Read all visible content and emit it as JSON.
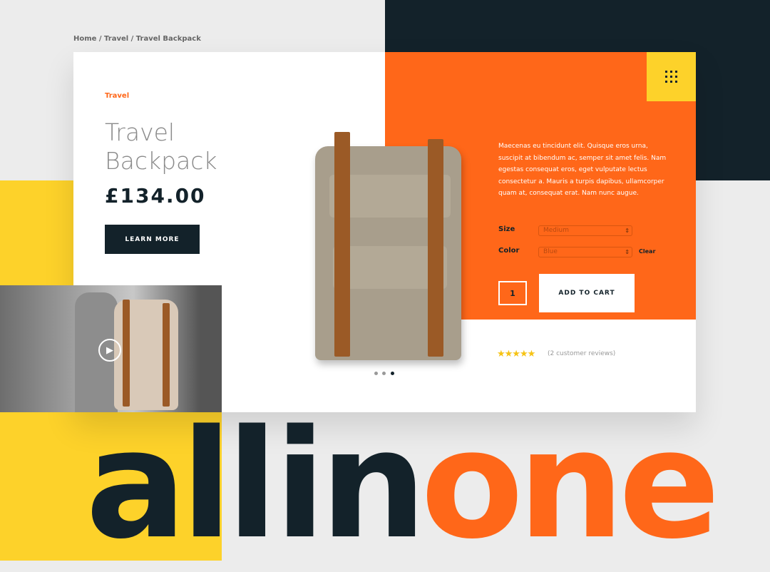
{
  "breadcrumb": "Home / Travel / Travel Backpack",
  "product": {
    "category": "Travel",
    "title": "Travel Backpack",
    "price": "£134.00",
    "learn_more": "LEARN MORE",
    "description": "Maecenas eu tincidunt elit. Quisque eros urna, suscipit at bibendum ac, semper sit amet felis. Nam egestas consequat eros, eget vulputate lectus consectetur a. Mauris a turpis dapibus, ullamcorper quam at, consequat erat. Nam nunc augue.",
    "size_label": "Size",
    "size_value": "Medium",
    "color_label": "Color",
    "color_value": "Blue",
    "clear": "Clear",
    "quantity": "1",
    "add_to_cart": "ADD TO CART",
    "rating": 4.5,
    "stars": "★★★★★",
    "reviews": "(2 customer reviews)"
  },
  "carousel": {
    "slides": 3,
    "active": 3
  },
  "headline": {
    "word1": "all",
    "word2": "in",
    "word3": "one"
  },
  "colors": {
    "orange": "#ff6719",
    "dark": "#13222a",
    "yellow": "#fdd22a"
  },
  "icons": [
    "grid-menu-icon",
    "play-icon",
    "star-icon"
  ]
}
